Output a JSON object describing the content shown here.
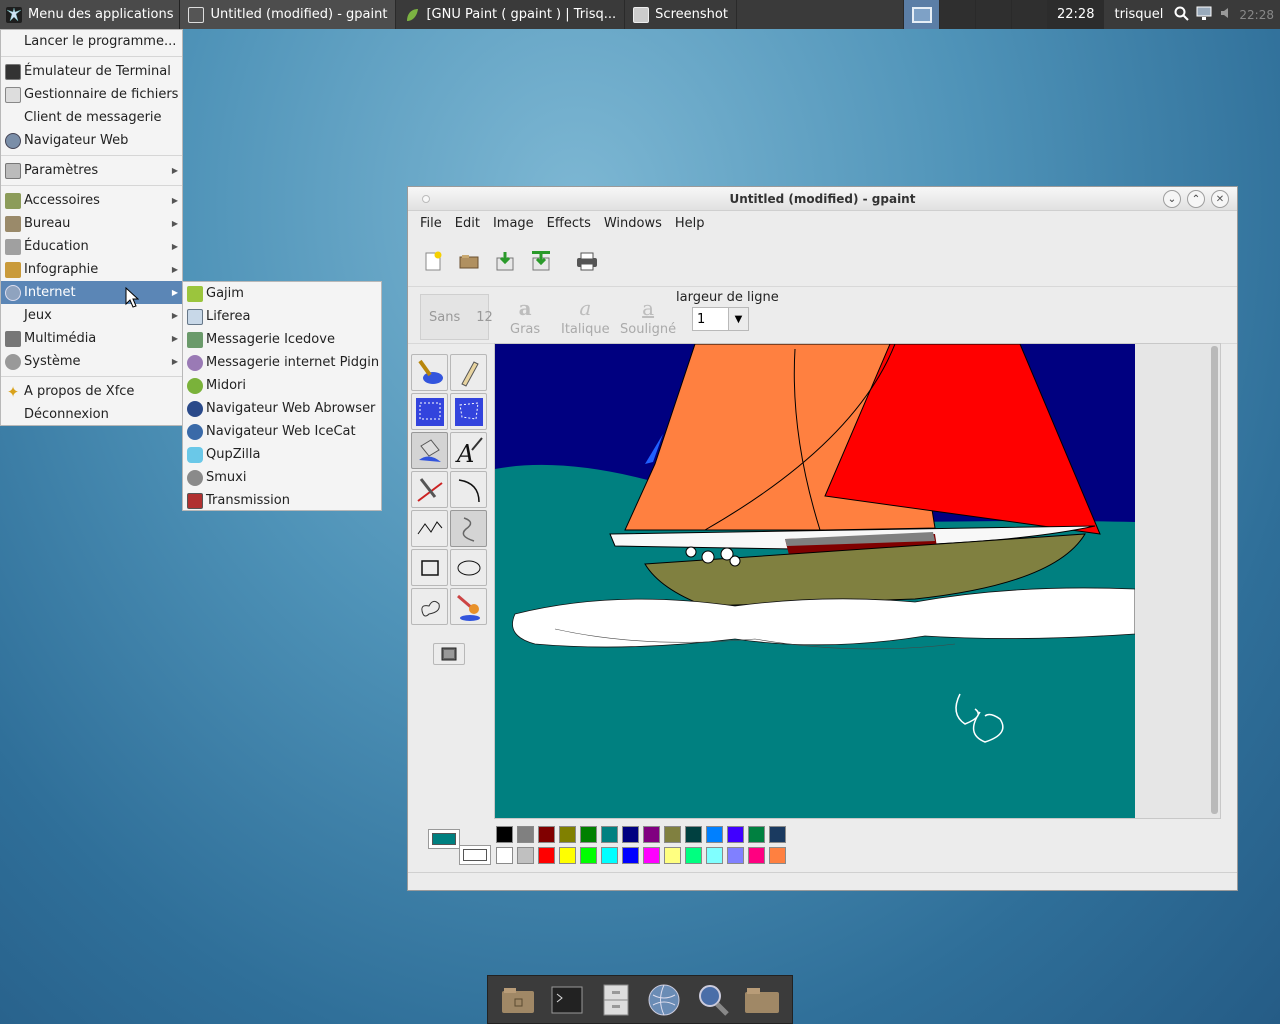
{
  "panel": {
    "app_menu_label": "Menu des applications",
    "tasks": [
      {
        "label": "Untitled (modified) - gpaint"
      },
      {
        "label": "[GNU Paint ( gpaint ) | Trisq..."
      },
      {
        "label": "Screenshot"
      }
    ],
    "clock": "22:28",
    "user": "trisquel",
    "tray_clock": "22:28"
  },
  "app_menu": {
    "items": [
      {
        "label": "Lancer le programme..."
      },
      {
        "label": "Émulateur de Terminal"
      },
      {
        "label": "Gestionnaire de fichiers"
      },
      {
        "label": "Client de messagerie"
      },
      {
        "label": "Navigateur Web"
      },
      {
        "label": "Paramètres"
      },
      {
        "label": "Accessoires"
      },
      {
        "label": "Bureau"
      },
      {
        "label": "Éducation"
      },
      {
        "label": "Infographie"
      },
      {
        "label": "Internet"
      },
      {
        "label": "Jeux"
      },
      {
        "label": "Multimédia"
      },
      {
        "label": "Système"
      },
      {
        "label": "A propos de Xfce"
      },
      {
        "label": "Déconnexion"
      }
    ],
    "selected": "Internet"
  },
  "internet_submenu": {
    "items": [
      {
        "label": "Gajim"
      },
      {
        "label": "Liferea"
      },
      {
        "label": "Messagerie Icedove"
      },
      {
        "label": "Messagerie internet Pidgin"
      },
      {
        "label": "Midori"
      },
      {
        "label": "Navigateur Web Abrowser"
      },
      {
        "label": "Navigateur Web IceCat"
      },
      {
        "label": "QupZilla"
      },
      {
        "label": "Smuxi"
      },
      {
        "label": "Transmission"
      }
    ]
  },
  "gpaint": {
    "title": "Untitled (modified) - gpaint",
    "menus": [
      "File",
      "Edit",
      "Image",
      "Effects",
      "Windows",
      "Help"
    ],
    "font": {
      "name": "Sans",
      "size": "12"
    },
    "styles": {
      "bold": "Gras",
      "italic": "Italique",
      "underline": "Souligné"
    },
    "style_glyph": "a",
    "line_width_label": "largeur de ligne",
    "line_width_value": "1",
    "foreground_color": "#008080",
    "background_color": "#ffffff",
    "palette": [
      [
        "#000000",
        "#808080",
        "#800000",
        "#808000",
        "#008000",
        "#008080",
        "#000080",
        "#800080",
        "#808040",
        "#004040",
        "#0080ff",
        "#4000ff",
        "#008040",
        "#1a3a60"
      ],
      [
        "#ffffff",
        "#c0c0c0",
        "#ff0000",
        "#ffff00",
        "#00ff00",
        "#00ffff",
        "#0000ff",
        "#ff00ff",
        "#ffff80",
        "#00ff80",
        "#80ffff",
        "#8080ff",
        "#ff0080",
        "#ff8040"
      ]
    ]
  },
  "colors": {
    "sea": "#008080",
    "sky": "#000080",
    "orange_sail": "#ff8040",
    "red_sail": "#ff0000",
    "hull": "#808040"
  }
}
